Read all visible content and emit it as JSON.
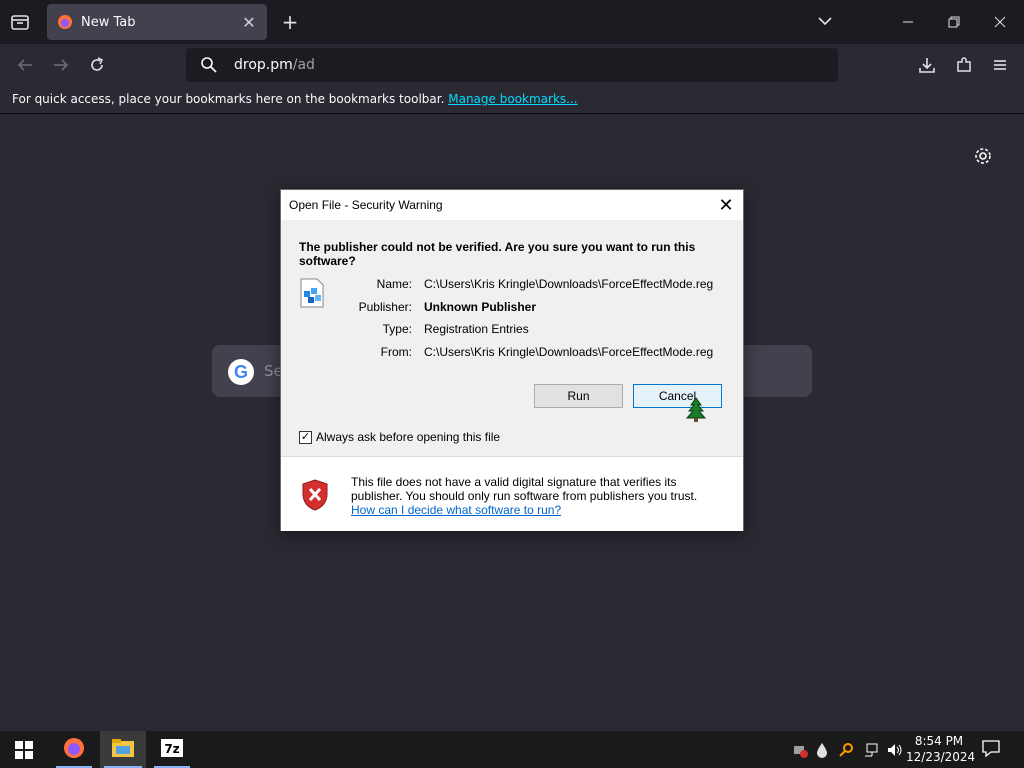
{
  "browser": {
    "tab_title": "New Tab",
    "url_host": "drop.pm",
    "url_path": "/ad",
    "bookmarks_hint": "For quick access, place your bookmarks here on the bookmarks toolbar.",
    "manage_bookmarks": "Manage bookmarks...",
    "search_placeholder": "Se"
  },
  "dialog": {
    "title": "Open File - Security Warning",
    "question": "The publisher could not be verified.  Are you sure you want to run this software?",
    "fields": [
      {
        "label": "Name:",
        "value": "C:\\Users\\Kris Kringle\\Downloads\\ForceEffectMode.reg"
      },
      {
        "label": "Publisher:",
        "value": "Unknown Publisher"
      },
      {
        "label": "Type:",
        "value": "Registration Entries"
      },
      {
        "label": "From:",
        "value": "C:\\Users\\Kris Kringle\\Downloads\\ForceEffectMode.reg"
      }
    ],
    "run_label": "Run",
    "cancel_label": "Cancel",
    "checkbox_label": "Always ask before opening this file",
    "checkbox_checked": true,
    "warning_text": "This file does not have a valid digital signature that verifies its publisher.  You should only run software from publishers you trust.",
    "help_link": "How can I decide what software to run?"
  },
  "taskbar": {
    "time": "8:54 PM",
    "date": "12/23/2024",
    "apps": [
      "start-button",
      "firefox-icon",
      "file-explorer-icon",
      "7zip-icon"
    ]
  },
  "colors": {
    "browser_bg": "#2b2a33",
    "tabbar_bg": "#1c1b22",
    "link": "#00ddff",
    "dialog_bg": "#f0f0f0",
    "default_button_border": "#0078d7"
  }
}
